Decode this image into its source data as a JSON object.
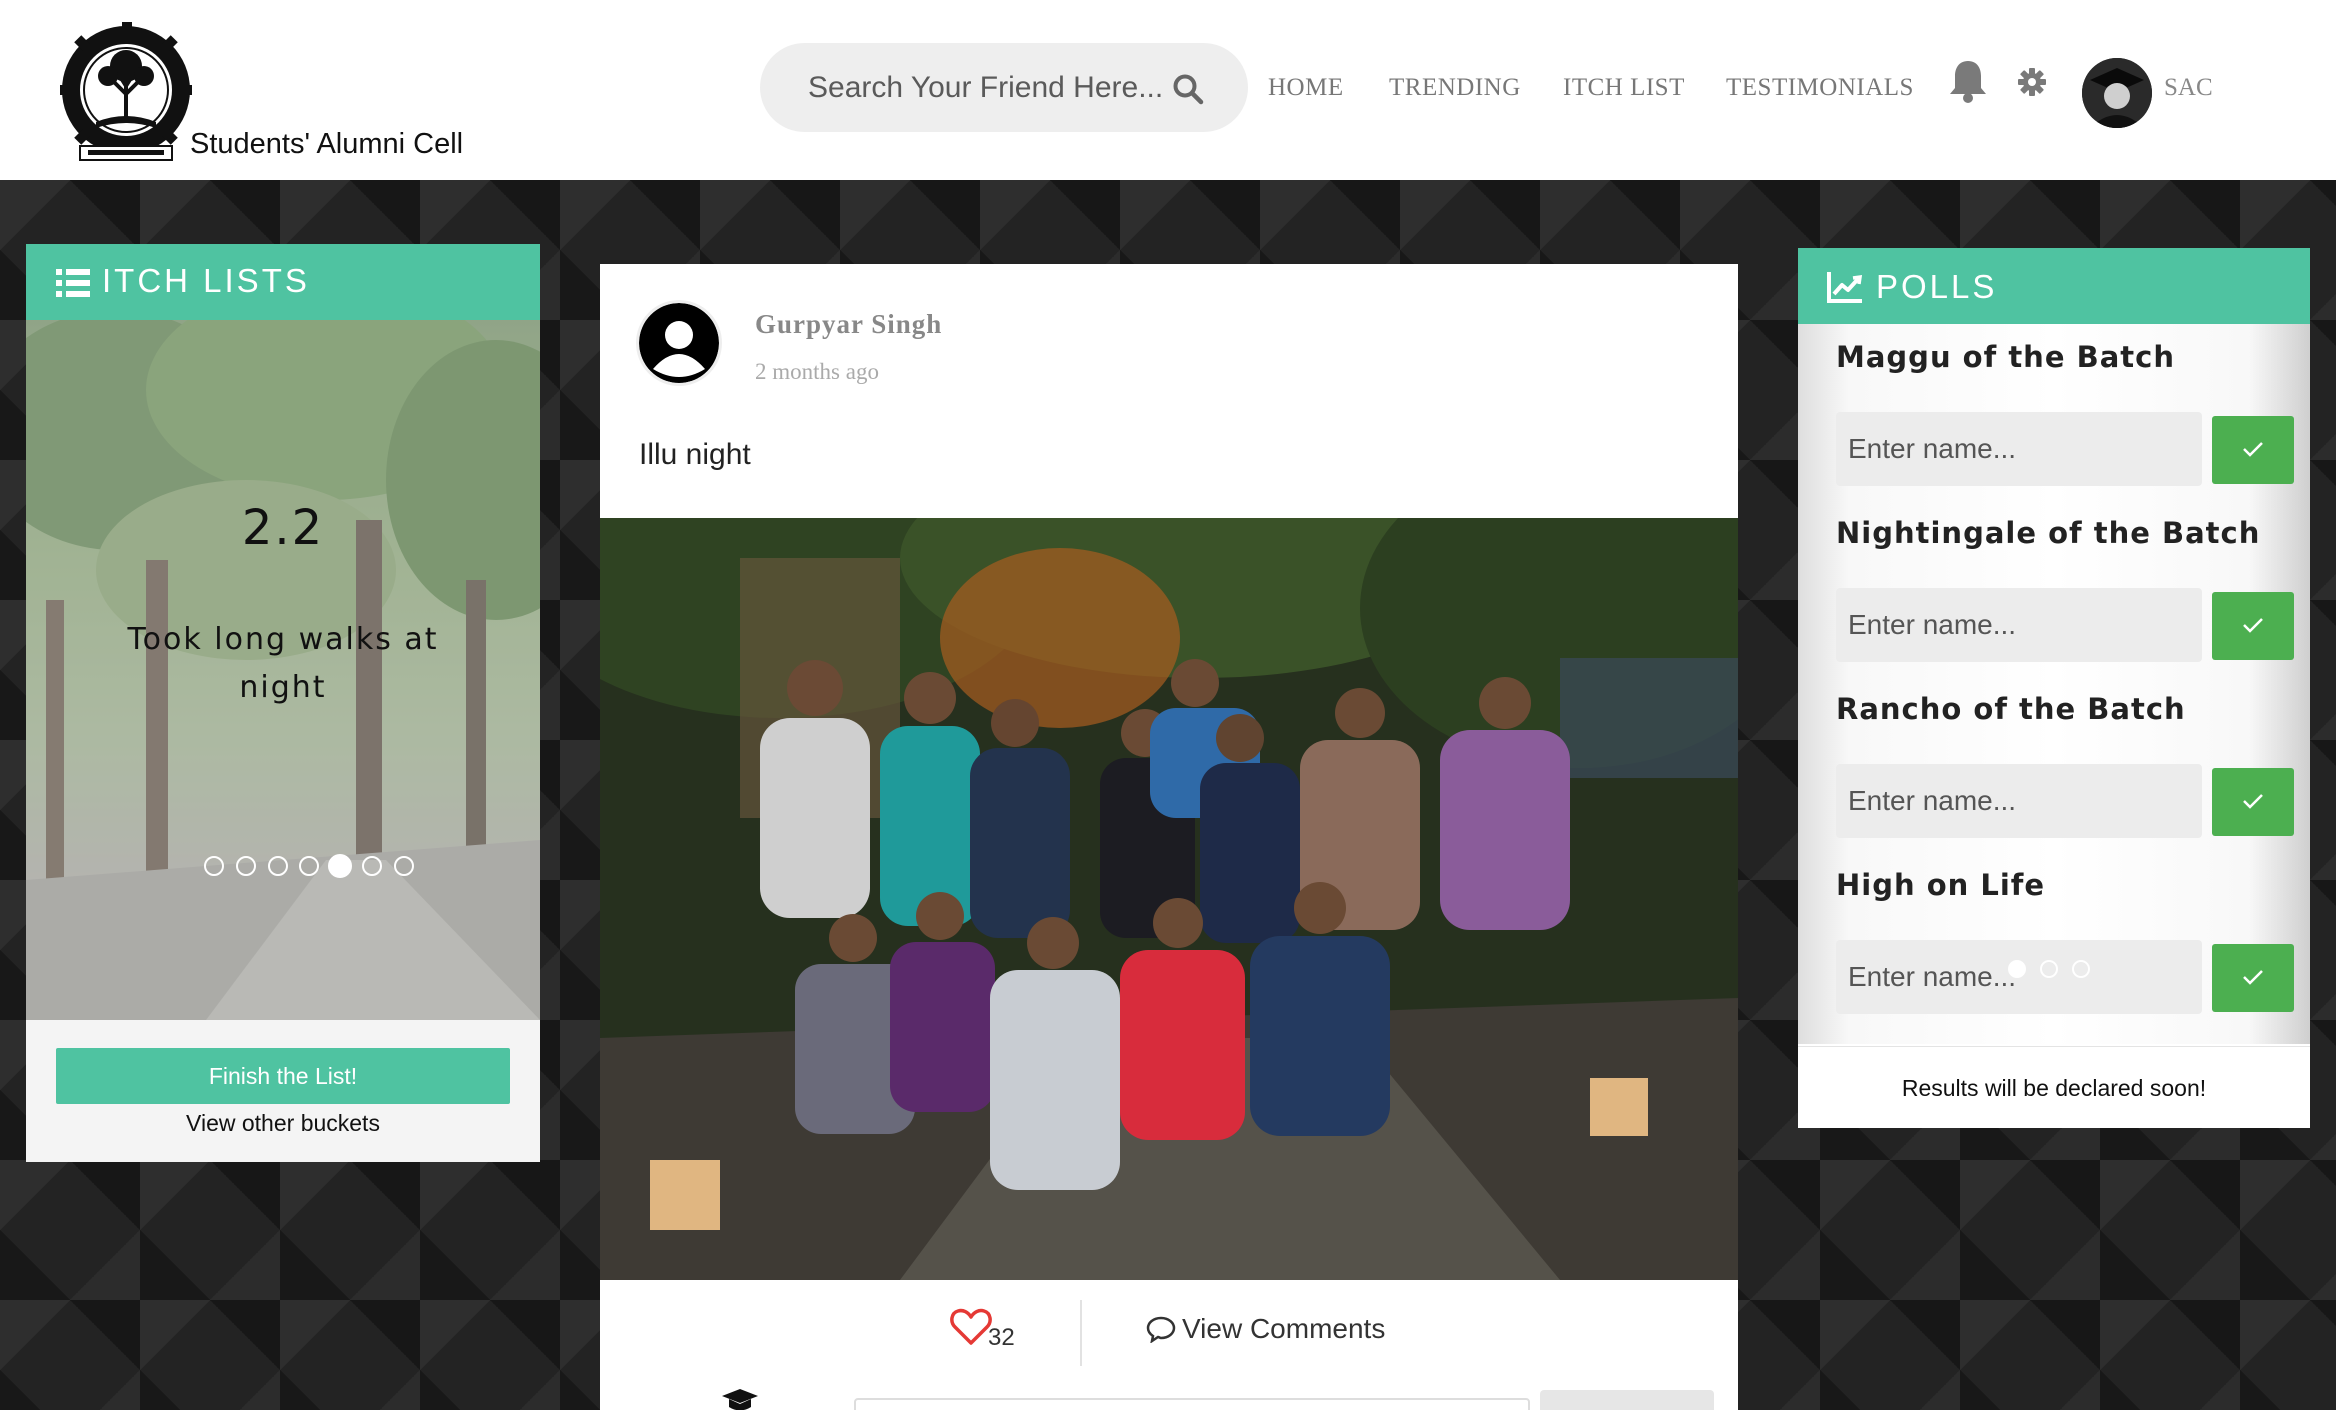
{
  "header": {
    "logo_text": "Students' Alumni Cell",
    "search_placeholder": "Search Your Friend Here...",
    "nav": [
      {
        "label": "HOME"
      },
      {
        "label": "TRENDING"
      },
      {
        "label": "ITCH LIST"
      },
      {
        "label": "TESTIMONIALS"
      }
    ],
    "user_label": "SAC",
    "icons": [
      "search-icon",
      "bell-icon",
      "gear-icon"
    ]
  },
  "itch_lists": {
    "title": "ITCH LISTS",
    "slide_number": "2.2",
    "slide_text": "Took long walks at night",
    "slide_count": 7,
    "active_slide": 5,
    "finish_button": "Finish the List!",
    "other_link": "View other buckets"
  },
  "post": {
    "author": "Gurpyar Singh",
    "time": "2 months ago",
    "text": "Illu night",
    "likes": "32",
    "view_comments": "View Comments"
  },
  "polls": {
    "title": "POLLS",
    "items": [
      {
        "question": "Maggu of the Batch",
        "placeholder": "Enter name..."
      },
      {
        "question": "Nightingale of the Batch",
        "placeholder": "Enter name..."
      },
      {
        "question": "Rancho of the Batch",
        "placeholder": "Enter name..."
      },
      {
        "question": "High on Life",
        "placeholder": "Enter name..."
      }
    ],
    "slide_count": 3,
    "active_slide": 1,
    "results_text": "Results will be declared soon!"
  },
  "colors": {
    "accent": "#4fc3a1",
    "poll_button": "#4caf50",
    "heart": "#e53935"
  }
}
